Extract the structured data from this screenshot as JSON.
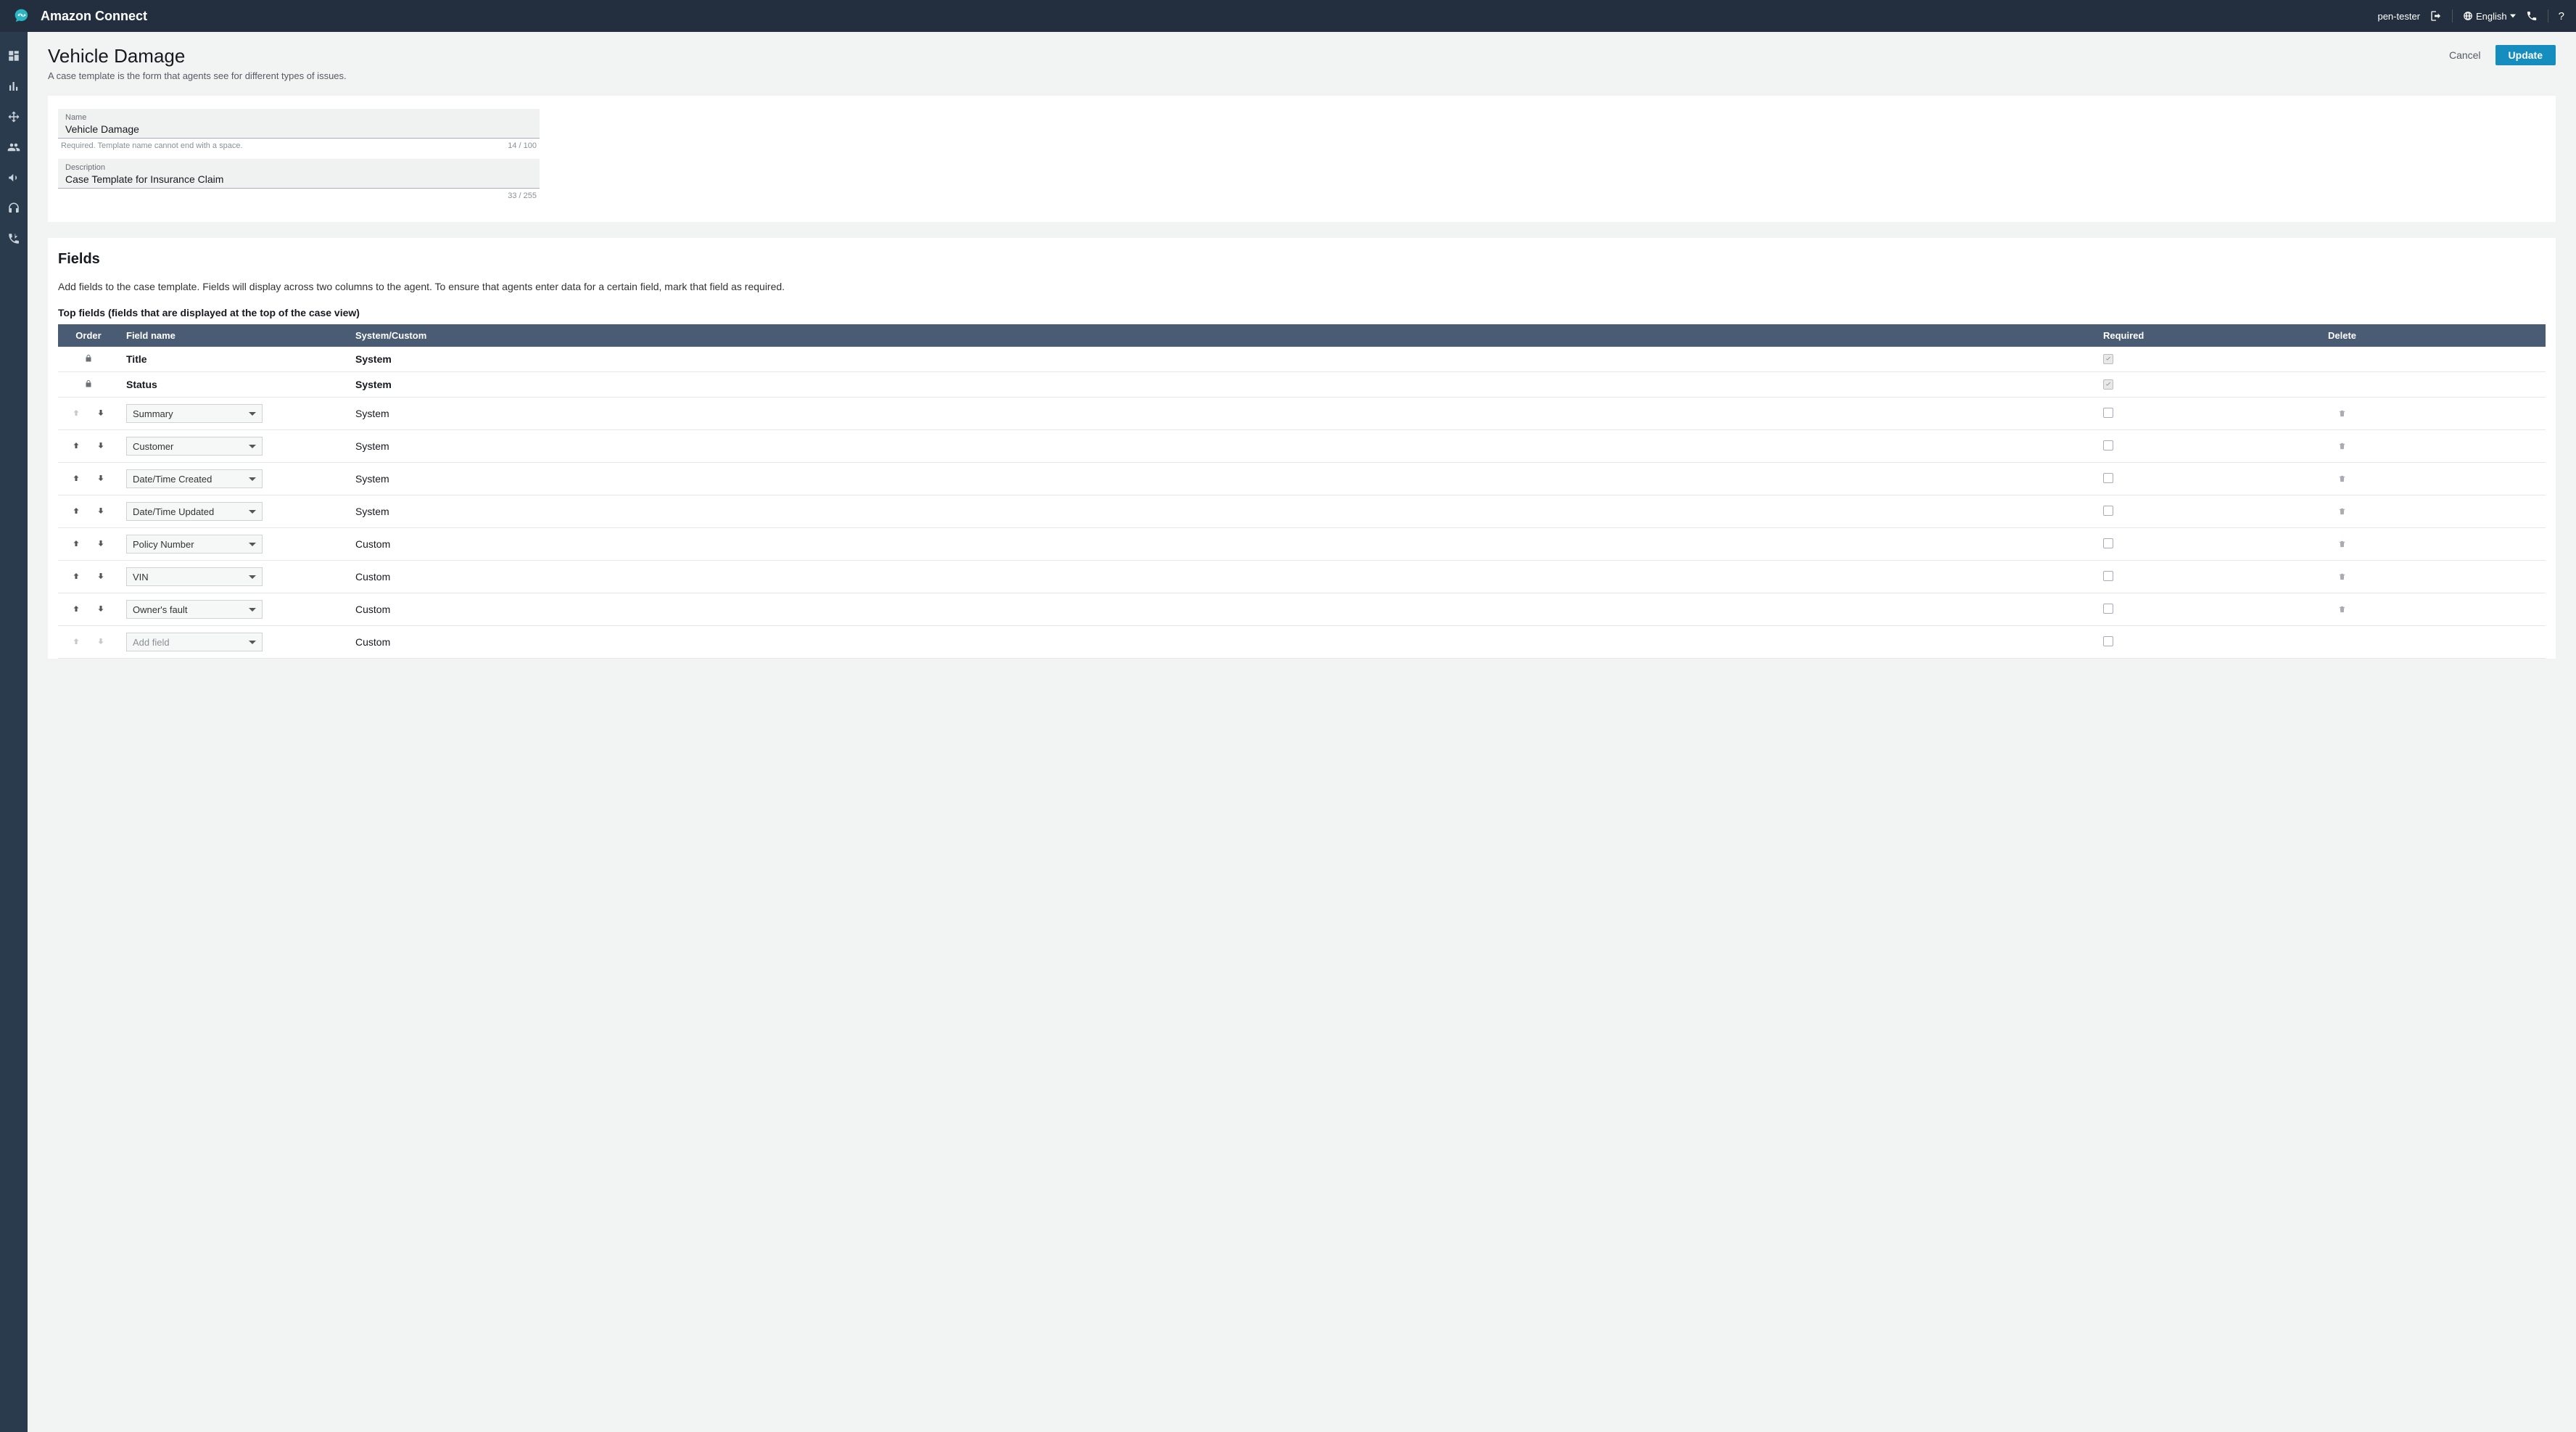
{
  "header": {
    "brand": "Amazon Connect",
    "user": "pen-tester",
    "language": "English"
  },
  "page": {
    "title": "Vehicle Damage",
    "subtitle": "A case template is the form that agents see for different types of issues.",
    "cancel_label": "Cancel",
    "update_label": "Update"
  },
  "form": {
    "name_label": "Name",
    "name_value": "Vehicle Damage",
    "name_helper": "Required.  Template name cannot end with a space.",
    "name_counter": "14 / 100",
    "desc_label": "Description",
    "desc_value": "Case Template for Insurance Claim",
    "desc_counter": "33 / 255"
  },
  "fields_section": {
    "title": "Fields",
    "description": "Add fields to the case template. Fields will display across two columns to the agent. To ensure that agents enter data for a certain field, mark that field as required.",
    "top_fields_title": "Top fields (fields that are displayed at the top of the case view)",
    "columns": {
      "order": "Order",
      "field_name": "Field name",
      "system_custom": "System/Custom",
      "required": "Required",
      "delete": "Delete"
    },
    "rows": [
      {
        "locked": true,
        "name": "Title",
        "type": "System",
        "required_locked": true,
        "up_disabled": true,
        "down_disabled": true,
        "deletable": false
      },
      {
        "locked": true,
        "name": "Status",
        "type": "System",
        "required_locked": true,
        "up_disabled": true,
        "down_disabled": true,
        "deletable": false
      },
      {
        "locked": false,
        "name": "Summary",
        "type": "System",
        "up_disabled": true,
        "down_disabled": false,
        "deletable": true
      },
      {
        "locked": false,
        "name": "Customer",
        "type": "System",
        "up_disabled": false,
        "down_disabled": false,
        "deletable": true
      },
      {
        "locked": false,
        "name": "Date/Time Created",
        "type": "System",
        "up_disabled": false,
        "down_disabled": false,
        "deletable": true
      },
      {
        "locked": false,
        "name": "Date/Time Updated",
        "type": "System",
        "up_disabled": false,
        "down_disabled": false,
        "deletable": true
      },
      {
        "locked": false,
        "name": "Policy Number",
        "type": "Custom",
        "up_disabled": false,
        "down_disabled": false,
        "deletable": true
      },
      {
        "locked": false,
        "name": "VIN",
        "type": "Custom",
        "up_disabled": false,
        "down_disabled": false,
        "deletable": true
      },
      {
        "locked": false,
        "name": "Owner's fault",
        "type": "Custom",
        "up_disabled": false,
        "down_disabled": false,
        "deletable": true
      },
      {
        "locked": false,
        "name": "Add field",
        "placeholder": true,
        "type": "Custom",
        "up_disabled": true,
        "down_disabled": true,
        "deletable": false
      }
    ]
  }
}
